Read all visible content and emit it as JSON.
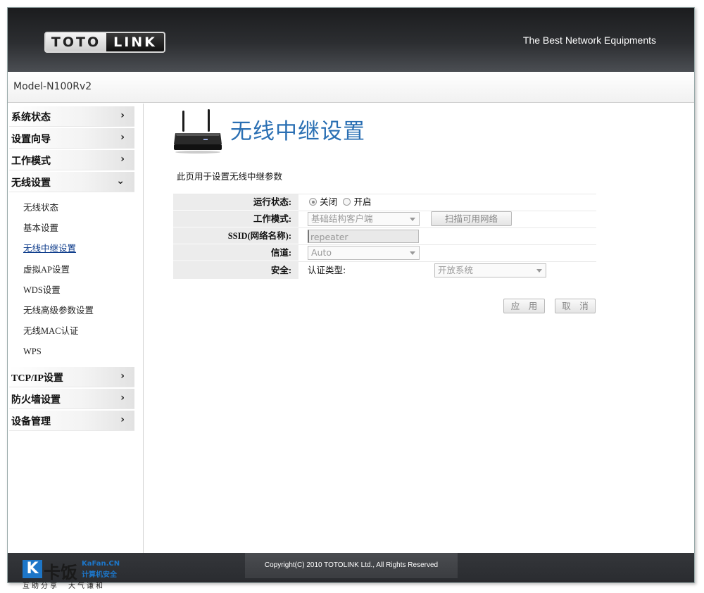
{
  "header": {
    "logo_left": "TOTO",
    "logo_right": "LINK",
    "slogan": "The Best Network Equipments"
  },
  "model": "Model-N100Rv2",
  "sidebar": {
    "items_top": [
      {
        "label": "系统状态",
        "chevron": "›"
      },
      {
        "label": "设置向导",
        "chevron": "›"
      },
      {
        "label": "工作模式",
        "chevron": "›"
      },
      {
        "label": "无线设置",
        "chevron": "⌄"
      }
    ],
    "submenu": [
      {
        "label": "无线状态"
      },
      {
        "label": "基本设置"
      },
      {
        "label": "无线中继设置",
        "active": true
      },
      {
        "label": "虚拟AP设置"
      },
      {
        "label": "WDS设置"
      },
      {
        "label": "无线高级参数设置"
      },
      {
        "label": "无线MAC认证"
      },
      {
        "label": "WPS"
      }
    ],
    "items_bottom": [
      {
        "label": "TCP/IP设置",
        "chevron": "›"
      },
      {
        "label": "防火墙设置",
        "chevron": "›"
      },
      {
        "label": "设备管理",
        "chevron": "›"
      }
    ]
  },
  "main": {
    "title": "无线中继设置",
    "description": "此页用于设置无线中继参数",
    "form": {
      "status_label": "运行状态:",
      "status_off": "关闭",
      "status_on": "开启",
      "mode_label": "工作模式:",
      "mode_value": "基础结构客户端",
      "scan_button": "扫描可用网络",
      "ssid_label": "SSID(网络名称):",
      "ssid_value": "repeater",
      "channel_label": "信道:",
      "channel_value": "Auto",
      "security_label": "安全:",
      "auth_label": "认证类型:",
      "auth_value": "开放系统"
    },
    "apply_button": "应　用",
    "cancel_button": "取　消"
  },
  "footer": {
    "copyright": "Copyright(C) 2010 TOTOLINK Ltd.,   All Rights Reserved"
  },
  "watermark": {
    "k": "K",
    "cn": "卡饭",
    "site": "KaFan.CN",
    "sub": "计算机安全",
    "slogan": "互助分享　大气谦和"
  }
}
